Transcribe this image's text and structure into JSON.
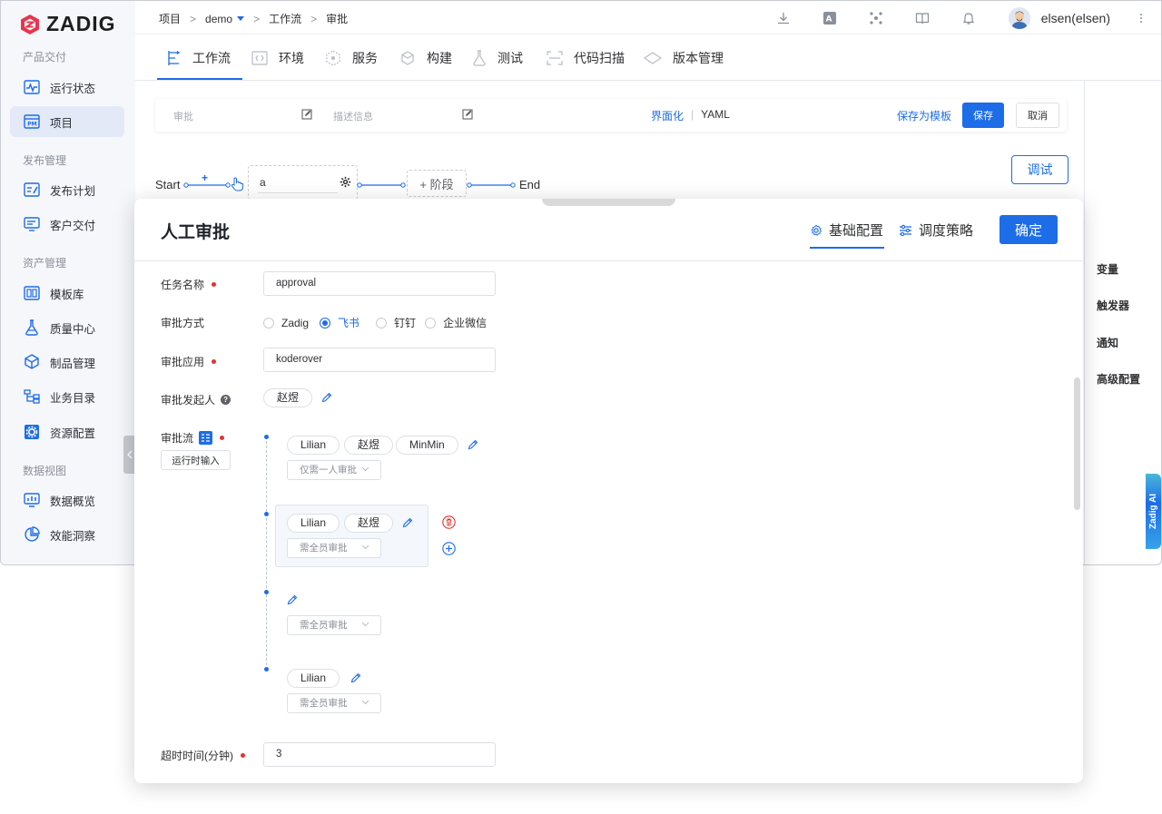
{
  "app": {
    "brand": "ZADIG",
    "colors": {
      "primary": "#1d6ce8",
      "logo": "#e8344e",
      "danger": "#e5322d"
    }
  },
  "sidebar": {
    "groups": [
      {
        "title": "产品交付",
        "items": [
          {
            "label": "运行状态",
            "icon": "activity-icon"
          },
          {
            "label": "项目",
            "icon": "project-icon",
            "active": true
          }
        ]
      },
      {
        "title": "发布管理",
        "items": [
          {
            "label": "发布计划",
            "icon": "release-plan-icon"
          },
          {
            "label": "客户交付",
            "icon": "customer-delivery-icon"
          }
        ]
      },
      {
        "title": "资产管理",
        "items": [
          {
            "label": "模板库",
            "icon": "template-icon"
          },
          {
            "label": "质量中心",
            "icon": "flask-icon"
          },
          {
            "label": "制品管理",
            "icon": "package-icon"
          },
          {
            "label": "业务目录",
            "icon": "tree-icon"
          },
          {
            "label": "资源配置",
            "icon": "gear-icon"
          }
        ]
      },
      {
        "title": "数据视图",
        "items": [
          {
            "label": "数据概览",
            "icon": "dashboard-icon"
          },
          {
            "label": "效能洞察",
            "icon": "pie-chart-icon"
          }
        ]
      }
    ]
  },
  "topbar": {
    "breadcrumb": [
      "项目",
      "demo",
      "工作流",
      "审批"
    ],
    "user": "elsen(elsen)"
  },
  "tabs": [
    {
      "label": "工作流",
      "icon": "workflow-icon",
      "active": true
    },
    {
      "label": "环境",
      "icon": "env-icon"
    },
    {
      "label": "服务",
      "icon": "service-icon"
    },
    {
      "label": "构建",
      "icon": "build-icon"
    },
    {
      "label": "测试",
      "icon": "test-icon"
    },
    {
      "label": "代码扫描",
      "icon": "scan-icon"
    },
    {
      "label": "版本管理",
      "icon": "version-icon"
    }
  ],
  "workflow": {
    "name_placeholder": "审批",
    "desc_placeholder": "描述信息",
    "mode_ui": "界面化",
    "mode_yaml": "YAML",
    "save_template": "保存为模板",
    "save": "保存",
    "cancel": "取消",
    "debug": "调试",
    "start": "Start",
    "end": "End",
    "stage_name": "a",
    "add_stage": "+ 阶段",
    "add_symbol": "+"
  },
  "right_menu": [
    "变量",
    "触发器",
    "通知",
    "高级配置"
  ],
  "zadig_ai": "Zadig AI",
  "drawer": {
    "title": "人工审批",
    "tabs": [
      {
        "label": "基础配置",
        "icon": "gear-icon",
        "active": true
      },
      {
        "label": "调度策略",
        "icon": "sliders-icon"
      }
    ],
    "confirm": "确定",
    "fields": {
      "task_name_label": "任务名称",
      "task_name_value": "approval",
      "method_label": "审批方式",
      "methods": [
        {
          "label": "Zadig",
          "checked": false
        },
        {
          "label": "飞书",
          "checked": true
        },
        {
          "label": "钉钉",
          "checked": false
        },
        {
          "label": "企业微信",
          "checked": false
        }
      ],
      "app_label": "审批应用",
      "app_value": "koderover",
      "initiator_label": "审批发起人",
      "initiator": "赵煜",
      "flow_label": "审批流",
      "runtime_input": "运行时输入",
      "timeout_label": "超时时间(分钟)",
      "timeout_value": "3"
    },
    "flow_nodes": [
      {
        "approvers": [
          "Lilian",
          "赵煜",
          "MinMin"
        ],
        "rule": "仅需一人审批"
      },
      {
        "approvers": [
          "Lilian",
          "赵煜"
        ],
        "rule": "需全员审批"
      },
      {
        "approvers": [],
        "rule": "需全员审批"
      },
      {
        "approvers": [
          "Lilian"
        ],
        "rule": "需全员审批"
      }
    ]
  }
}
